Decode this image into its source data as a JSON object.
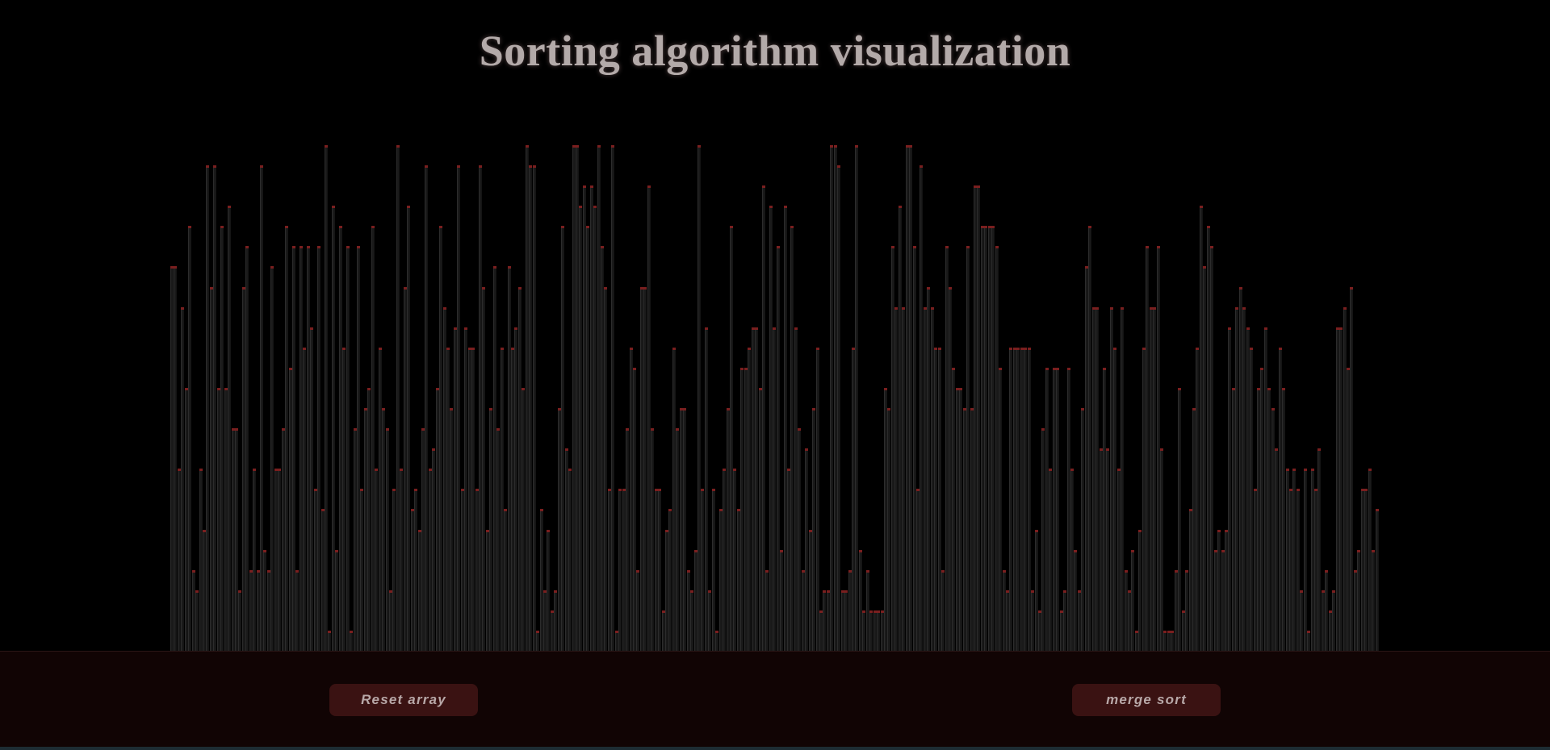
{
  "header": {
    "title": "Sorting algorithm visualization"
  },
  "controls": {
    "reset_label": "Reset array",
    "sort_label": "merge sort"
  },
  "colors": {
    "background": "#000000",
    "bar_fill": "#1a1a1a",
    "bar_tip": "#7a1f1f",
    "footer_background": "#110404",
    "button_background": "#3a1212",
    "button_text": "#b8a8a8",
    "title_text": "#b3aaa9"
  },
  "array": {
    "max": 25,
    "values": [
      19,
      19,
      9,
      17,
      13,
      21,
      4,
      3,
      9,
      6,
      24,
      18,
      24,
      13,
      21,
      13,
      22,
      11,
      11,
      3,
      18,
      20,
      4,
      9,
      4,
      24,
      5,
      4,
      19,
      9,
      9,
      11,
      21,
      14,
      20,
      4,
      20,
      15,
      20,
      16,
      8,
      20,
      7,
      25,
      1,
      22,
      5,
      21,
      15,
      20,
      1,
      11,
      20,
      8,
      12,
      13,
      21,
      9,
      15,
      12,
      11,
      3,
      8,
      25,
      9,
      18,
      22,
      7,
      8,
      6,
      11,
      24,
      9,
      10,
      13,
      21,
      17,
      15,
      12,
      16,
      24,
      8,
      16,
      15,
      15,
      8,
      24,
      18,
      6,
      12,
      19,
      11,
      15,
      7,
      19,
      15,
      16,
      18,
      13,
      25,
      24,
      24,
      1,
      7,
      3,
      6,
      2,
      3,
      12,
      21,
      10,
      9,
      25,
      25,
      22,
      23,
      21,
      23,
      22,
      25,
      20,
      18,
      8,
      25,
      1,
      8,
      8,
      11,
      15,
      14,
      4,
      18,
      18,
      23,
      11,
      8,
      8,
      2,
      6,
      7,
      15,
      11,
      12,
      12,
      4,
      3,
      5,
      25,
      8,
      16,
      3,
      8,
      1,
      7,
      9,
      12,
      21,
      9,
      7,
      14,
      14,
      15,
      16,
      16,
      13,
      23,
      4,
      22,
      16,
      20,
      5,
      22,
      9,
      21,
      16,
      11,
      4,
      10,
      6,
      12,
      15,
      2,
      3,
      3,
      25,
      25,
      24,
      3,
      3,
      4,
      15,
      25,
      5,
      2,
      4,
      2,
      2,
      2,
      2,
      13,
      12,
      20,
      17,
      22,
      17,
      25,
      25,
      20,
      8,
      24,
      17,
      18,
      17,
      15,
      15,
      4,
      20,
      18,
      14,
      13,
      13,
      12,
      20,
      12,
      23,
      23,
      21,
      21,
      21,
      21,
      20,
      14,
      4,
      3,
      15,
      15,
      15,
      15,
      15,
      15,
      3,
      6,
      2,
      11,
      14,
      9,
      14,
      14,
      2,
      3,
      14,
      9,
      5,
      3,
      12,
      19,
      21,
      17,
      17,
      10,
      14,
      10,
      17,
      15,
      9,
      17,
      4,
      3,
      5,
      1,
      6,
      15,
      20,
      17,
      17,
      20,
      10,
      1,
      1,
      1,
      4,
      13,
      2,
      4,
      7,
      12,
      15,
      22,
      19,
      21,
      20,
      5,
      6,
      5,
      6,
      16,
      13,
      17,
      18,
      17,
      16,
      15,
      8,
      13,
      14,
      16,
      13,
      12,
      10,
      15,
      13,
      9,
      8,
      9,
      8,
      3,
      9,
      1,
      9,
      8,
      10,
      3,
      4,
      2,
      3,
      16,
      16,
      17,
      14,
      18,
      4,
      5,
      8,
      8,
      9,
      5,
      7
    ]
  }
}
